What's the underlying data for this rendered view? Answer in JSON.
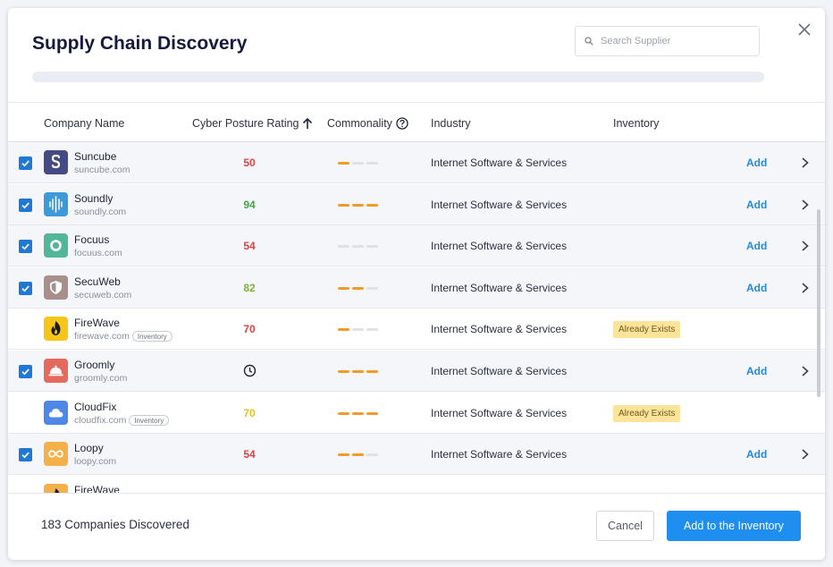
{
  "dialog": {
    "title": "Supply Chain Discovery",
    "search_placeholder": "Search Supplier",
    "progress_fraction": 0
  },
  "columns": {
    "company": "Company Name",
    "rating": "Cyber Posture Rating",
    "commonality": "Commonality",
    "industry": "Industry",
    "inventory": "Inventory"
  },
  "rows": [
    {
      "selected": true,
      "name": "Suncube",
      "domain": "suncube.com",
      "rating": "50",
      "rating_color": "#e0413e",
      "commonality": 1,
      "industry": "Internet Software & Services",
      "action": "Add",
      "logo_bg": "#434a85",
      "logo_icon": "s-letter-icon"
    },
    {
      "selected": true,
      "name": "Soundly",
      "domain": "soundly.com",
      "rating": "94",
      "rating_color": "#3fa83f",
      "commonality": 3,
      "industry": "Internet Software & Services",
      "action": "Add",
      "logo_bg": "#3d9ad9",
      "logo_icon": "sound-wave-icon"
    },
    {
      "selected": true,
      "name": "Focuus",
      "domain": "focuus.com",
      "rating": "54",
      "rating_color": "#e0413e",
      "commonality": 0,
      "industry": "Internet Software & Services",
      "action": "Add",
      "logo_bg": "#52b79a",
      "logo_icon": "ring-icon"
    },
    {
      "selected": true,
      "name": "SecuWeb",
      "domain": "secuweb.com",
      "rating": "82",
      "rating_color": "#7fb23a",
      "commonality": 2,
      "industry": "Internet Software & Services",
      "action": "Add",
      "logo_bg": "#a88f8b",
      "logo_icon": "shield-icon"
    },
    {
      "selected": false,
      "name": "FireWave",
      "domain": "firewave.com",
      "inventory_tag": "Inventory",
      "rating": "70",
      "rating_color": "#e0413e",
      "commonality": 1,
      "industry": "Internet Software & Services",
      "status": "Already Exists",
      "logo_bg": "#f5c518",
      "logo_icon": "flame-icon"
    },
    {
      "selected": true,
      "name": "Groomly",
      "domain": "groomly.com",
      "rating": "",
      "rating_pending": true,
      "commonality": 3,
      "industry": "Internet Software & Services",
      "action": "Add",
      "logo_bg": "#e46a5e",
      "logo_icon": "cloche-icon"
    },
    {
      "selected": false,
      "name": "CloudFix",
      "domain": "cloudfix.com",
      "inventory_tag": "Inventory",
      "rating": "70",
      "rating_color": "#e6c21a",
      "commonality": 3,
      "industry": "Internet Software & Services",
      "status": "Already Exists",
      "logo_bg": "#4f87e8",
      "logo_icon": "cloud-icon"
    },
    {
      "selected": true,
      "name": "Loopy",
      "domain": "loopy.com",
      "rating": "54",
      "rating_color": "#e0413e",
      "commonality": 2,
      "industry": "Internet Software & Services",
      "action": "Add",
      "logo_bg": "#f4b04a",
      "logo_icon": "infinity-icon"
    },
    {
      "selected": false,
      "name": "FireWave",
      "domain": "",
      "rating": "",
      "commonality": 0,
      "industry": "",
      "logo_bg": "#f4b04a",
      "logo_icon": "flame-icon",
      "partial": true
    }
  ],
  "footer": {
    "count_text": "183 Companies Discovered",
    "cancel_label": "Cancel",
    "add_label": "Add to the Inventory"
  },
  "colors": {
    "accent": "#1f8ef1",
    "checkbox": "#1f78d1",
    "commonality_on": "#f29a2e"
  }
}
